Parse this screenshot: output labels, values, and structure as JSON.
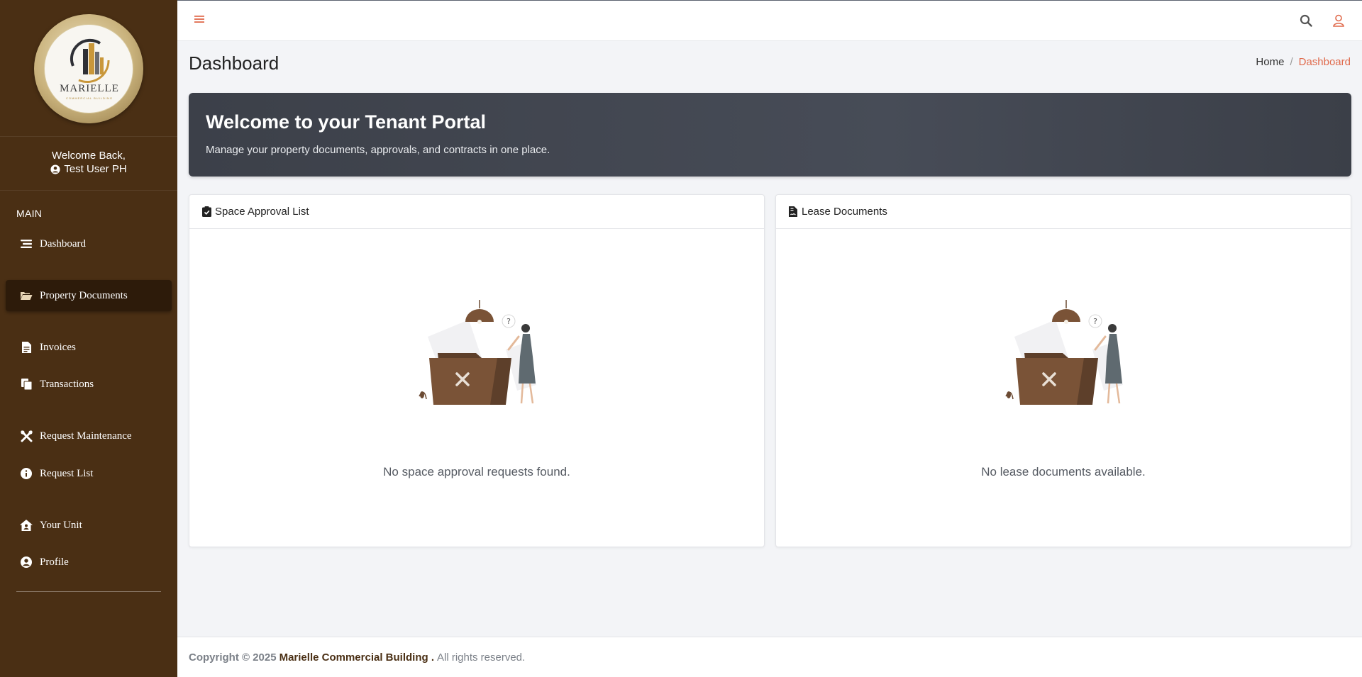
{
  "sidebar": {
    "logo_text": "MARIELLE",
    "logo_subtext": "COMMERCIAL BUILDING",
    "welcome_line": "Welcome Back,",
    "user_name": "Test User PH",
    "section_label": "MAIN",
    "items": [
      {
        "label": "Dashboard",
        "icon": "list-icon"
      },
      {
        "label": "Property Documents",
        "icon": "folder-open-icon",
        "active": true
      },
      {
        "label": "Invoices",
        "icon": "invoice-icon"
      },
      {
        "label": "Transactions",
        "icon": "copy-icon"
      },
      {
        "label": "Request Maintenance",
        "icon": "tools-icon"
      },
      {
        "label": "Request List",
        "icon": "info-icon"
      },
      {
        "label": "Your Unit",
        "icon": "house-user-icon"
      },
      {
        "label": "Profile",
        "icon": "user-circle-icon"
      }
    ]
  },
  "topbar": {
    "menu_icon": "hamburger-icon",
    "search_icon": "search-icon",
    "user_icon": "user-icon"
  },
  "header": {
    "title": "Dashboard",
    "breadcrumb": {
      "home": "Home",
      "separator": "/",
      "current": "Dashboard"
    }
  },
  "banner": {
    "title": "Welcome to your Tenant Portal",
    "subtitle": "Manage your property documents, approvals, and contracts in one place."
  },
  "cards": {
    "space_approval": {
      "title": "Space Approval List",
      "icon": "clipboard-check-icon",
      "empty_text": "No space approval requests found."
    },
    "lease_documents": {
      "title": "Lease Documents",
      "icon": "file-contract-icon",
      "empty_text": "No lease documents available."
    }
  },
  "footer": {
    "copyright": "Copyright © 2025",
    "brand": "Marielle Commercial Building .",
    "rights": "All rights reserved."
  },
  "colors": {
    "sidebar_bg": "#4a2f14",
    "active_item_bg": "#2d1b0a",
    "accent": "#e06a4c",
    "banner_bg": "#3f434c",
    "page_bg": "#f3f4f7"
  }
}
